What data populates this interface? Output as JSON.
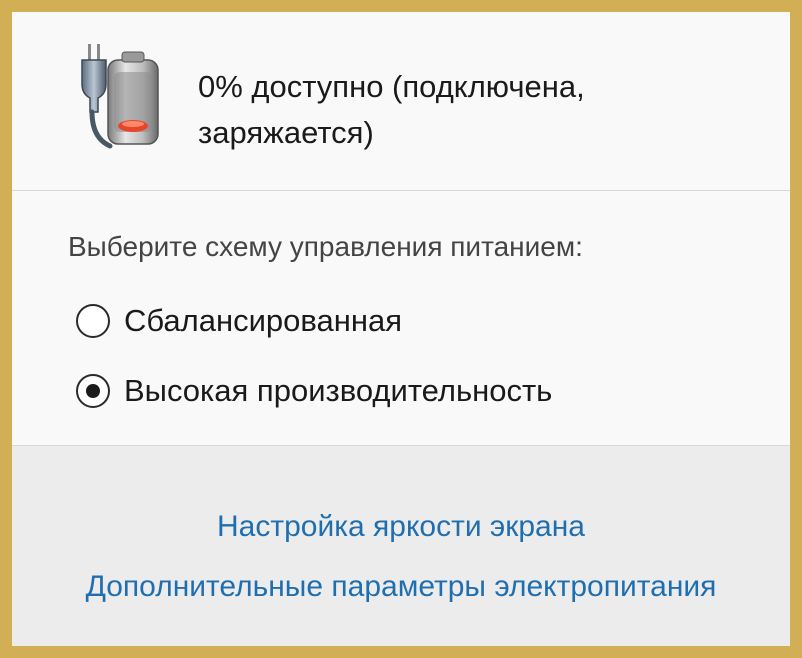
{
  "status": {
    "battery_text": "0% доступно (подключена, заряжается)",
    "icon": "battery-charging-plug-icon"
  },
  "plan": {
    "prompt": "Выберите схему управления питанием:",
    "options": [
      {
        "label": "Сбалансированная",
        "selected": false
      },
      {
        "label": "Высокая производительность",
        "selected": true
      }
    ]
  },
  "links": {
    "brightness": "Настройка яркости экрана",
    "power_options": "Дополнительные параметры электропитания"
  },
  "colors": {
    "frame": "#d2ae55",
    "link": "#1f6fb0",
    "panel": "#f9f9f9",
    "footer": "#ececec"
  }
}
